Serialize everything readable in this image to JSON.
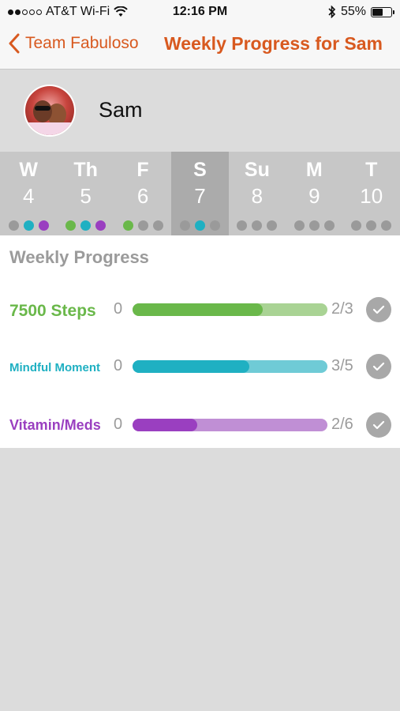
{
  "status_bar": {
    "signal_dots_filled": 2,
    "signal_dots_total": 5,
    "carrier": "AT&T Wi-Fi",
    "time": "12:16 PM",
    "battery": "55%",
    "battery_level": 0.55,
    "icons": [
      "wifi-icon",
      "bluetooth-icon",
      "battery-icon"
    ]
  },
  "nav": {
    "back_label": "Team Fabuloso",
    "title": "Weekly Progress for Sam",
    "accent_color": "#d8591f"
  },
  "profile": {
    "name": "Sam"
  },
  "calendar": {
    "days": [
      {
        "name": "W",
        "num": "4",
        "selected": false,
        "dots": [
          "#9a9a9a",
          "#1fb0c2",
          "#9a3fc0"
        ]
      },
      {
        "name": "Th",
        "num": "5",
        "selected": false,
        "dots": [
          "#6ab84a",
          "#1fb0c2",
          "#9a3fc0"
        ]
      },
      {
        "name": "F",
        "num": "6",
        "selected": false,
        "dots": [
          "#6ab84a",
          "#9a9a9a",
          "#9a9a9a"
        ]
      },
      {
        "name": "S",
        "num": "7",
        "selected": true,
        "dots": [
          "#9a9a9a",
          "#1fb0c2",
          "#9a9a9a"
        ]
      },
      {
        "name": "Su",
        "num": "8",
        "selected": false,
        "dots": [
          "#9a9a9a",
          "#9a9a9a",
          "#9a9a9a"
        ]
      },
      {
        "name": "M",
        "num": "9",
        "selected": false,
        "dots": [
          "#9a9a9a",
          "#9a9a9a",
          "#9a9a9a"
        ]
      },
      {
        "name": "T",
        "num": "10",
        "selected": false,
        "dots": [
          "#9a9a9a",
          "#9a9a9a",
          "#9a9a9a"
        ]
      }
    ]
  },
  "progress": {
    "title": "Weekly Progress",
    "goals": [
      {
        "label": "7500 Steps",
        "min": "0",
        "count": "2/3",
        "fraction": 0.667,
        "color": "#6ab84a",
        "light_color": "#a9d394"
      },
      {
        "label": "Mindful Moment",
        "min": "0",
        "count": "3/5",
        "fraction": 0.6,
        "color": "#1fb0c2",
        "light_color": "#6fcbd6"
      },
      {
        "label": "Vitamin/Meds",
        "min": "0",
        "count": "2/6",
        "fraction": 0.333,
        "color": "#9a3fc0",
        "light_color": "#c08fd5"
      }
    ]
  }
}
